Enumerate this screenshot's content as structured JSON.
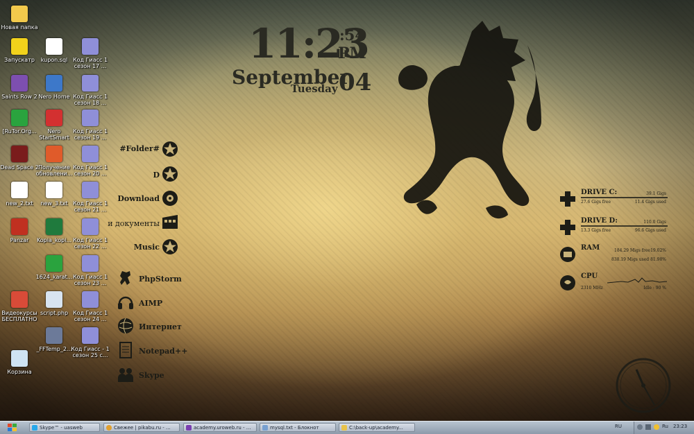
{
  "desktop_icons": [
    {
      "label": "Новая папка",
      "icon": "folder-icon",
      "color": "#f2c94c"
    },
    {
      "label": "Запускатр",
      "icon": "launcher-icon",
      "color": "#f2d21b"
    },
    {
      "label": "Saints Row 2",
      "icon": "saints-row-icon",
      "color": "#7d4fb0"
    },
    {
      "label": "[RuTor.Org...",
      "icon": "utorrent-icon",
      "color": "#2aa33e"
    },
    {
      "label": "Dead Space 2",
      "icon": "dead-space-icon",
      "color": "#7a1c1c"
    },
    {
      "label": "new_2.txt",
      "icon": "text-file-icon",
      "color": "#ffffff"
    },
    {
      "label": "Panzar",
      "icon": "panzar-icon",
      "color": "#c03020"
    },
    {
      "label": "Видеокурсы БЕСПЛАТНО",
      "icon": "chrome-icon",
      "color": "#d94b38"
    },
    {
      "label": "Корзина",
      "icon": "recycle-bin-icon",
      "color": "#cfe3f2"
    },
    {
      "label": "kupon.sql",
      "icon": "text-file-icon",
      "color": "#ffffff"
    },
    {
      "label": "Nero Home",
      "icon": "nero-home-icon",
      "color": "#3d78c9"
    },
    {
      "label": "Nero StartSmart",
      "icon": "nero-icon",
      "color": "#d33030"
    },
    {
      "label": "Получение обновлени...",
      "icon": "update-icon",
      "color": "#e05b2a"
    },
    {
      "label": "new_3.txt",
      "icon": "text-file-icon",
      "color": "#ffffff"
    },
    {
      "label": "Kopia_kopi...",
      "icon": "excel-icon",
      "color": "#1f7a3d"
    },
    {
      "label": "1624_karat...",
      "icon": "utorrent-icon",
      "color": "#2aa33e"
    },
    {
      "label": "script.php",
      "icon": "php-file-icon",
      "color": "#d8e4f0"
    },
    {
      "label": "_FFTemp_2...",
      "icon": "avi-file-icon",
      "color": "#6c7a99"
    },
    {
      "label": "Код Гиасс 1 сезон 17 ...",
      "icon": "video-file-icon",
      "color": "#8f8fd8"
    },
    {
      "label": "Код Гиасс 1 сезон 18 ...",
      "icon": "video-file-icon",
      "color": "#8f8fd8"
    },
    {
      "label": "Код Гиасс 1 сезон 19 ...",
      "icon": "video-file-icon",
      "color": "#8f8fd8"
    },
    {
      "label": "Код Гиасс 1 сезон 20 ...",
      "icon": "video-file-icon",
      "color": "#8f8fd8"
    },
    {
      "label": "Код Гиасс 1 сезон 21 ...",
      "icon": "video-file-icon",
      "color": "#8f8fd8"
    },
    {
      "label": "Код Гиасс 1 сезон 22 ...",
      "icon": "video-file-icon",
      "color": "#8f8fd8"
    },
    {
      "label": "Код Гиасс 1 сезон 23 ...",
      "icon": "video-file-icon",
      "color": "#8f8fd8"
    },
    {
      "label": "Код Гиасс 1 сезон 24 ...",
      "icon": "video-file-icon",
      "color": "#8f8fd8"
    },
    {
      "label": "Код Гиасс - 1 сезон 25 с...",
      "icon": "video-file-icon",
      "color": "#8f8fd8"
    }
  ],
  "clock": {
    "time": "11:23",
    "seconds": ":54",
    "ampm": "PM",
    "month": "September",
    "weekday": "Tuesday",
    "date": "04"
  },
  "folder_shortcuts": [
    {
      "label": "#Folder#",
      "icon": "star-seal-icon"
    },
    {
      "label": "D",
      "icon": "star-seal-icon"
    },
    {
      "label": "Download",
      "icon": "gear-seal-icon"
    },
    {
      "label": "и документы",
      "icon": "film-icon"
    },
    {
      "label": "Music",
      "icon": "star-seal-icon"
    }
  ],
  "launchers": [
    {
      "label": "PhpStorm",
      "icon": "lion-icon"
    },
    {
      "label": "AIMP",
      "icon": "headphones-icon"
    },
    {
      "label": "Интернет",
      "icon": "globe-icon"
    },
    {
      "label": "Notepad++",
      "icon": "notepad-icon"
    },
    {
      "label": "Skype",
      "icon": "people-icon"
    }
  ],
  "system_monitor": {
    "drive_c": {
      "name": "DRIVE C:",
      "total": "39.1 Gigs",
      "free": "27.6 Gigs free",
      "used": "11.4 Gigs used"
    },
    "drive_d": {
      "name": "DRIVE D:",
      "total": "110.0 Gigs",
      "free": "13.3 Gigs free",
      "used": "96.6 Gigs used"
    },
    "ram": {
      "name": "RAM",
      "free_line": "184.29 Migs free",
      "free_pct": "19.02%",
      "used_line": "838.19 Migs used",
      "used_pct": "81.98%"
    },
    "cpu": {
      "name": "CPU",
      "speed": "2310 MHz",
      "idle": "Idle : 90 %"
    }
  },
  "taskbar": {
    "tasks": [
      {
        "label": "Skype™ - uasweb",
        "color": "#28a8ea"
      },
      {
        "label": "Свежее | pikabu.ru - ...",
        "color": "#e0a030"
      },
      {
        "label": "academy.uroweb.ru - ...",
        "color": "#7a3fb0"
      },
      {
        "label": "mysql.txt - Блокнот",
        "color": "#78a0d0"
      },
      {
        "label": "C:\\back-up\\academy...",
        "color": "#e8c24a"
      }
    ],
    "language": "RU",
    "tray_lang": "Ru",
    "time": "23:23"
  },
  "colors": {
    "taskbar": "#9aa7b6",
    "ink": "#1c1c16"
  }
}
